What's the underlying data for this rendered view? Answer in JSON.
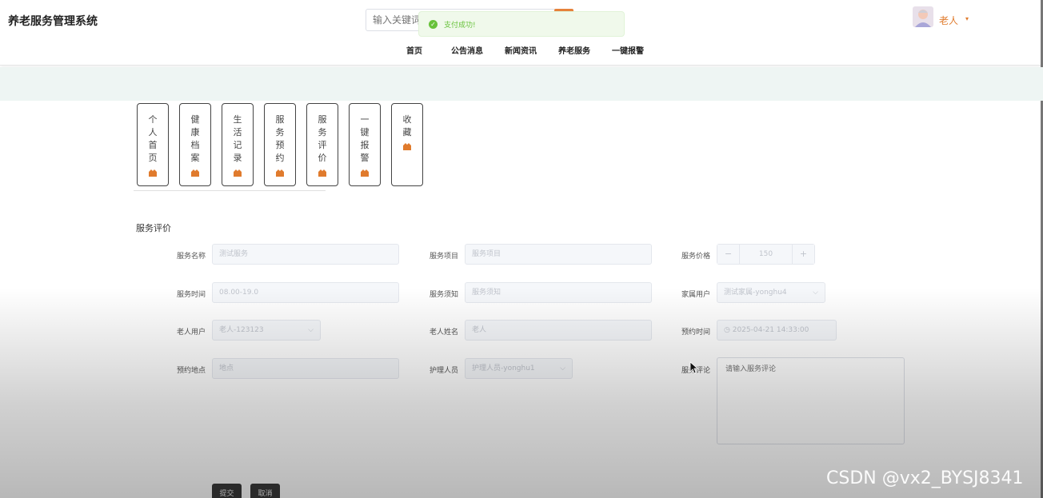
{
  "header": {
    "app_title": "养老服务管理系统",
    "search_placeholder": "输入关键词",
    "toast_message": "支付成功!",
    "nav": [
      "首页",
      "公告消息",
      "新闻资讯",
      "养老服务",
      "一键报警"
    ],
    "username": "老人",
    "caret": "▾"
  },
  "menu": [
    "个人首页",
    "健康档案",
    "生活记录",
    "服务预约",
    "服务评价",
    "一键报警",
    "收藏"
  ],
  "section_title": "服务评价",
  "form": {
    "service_name": {
      "label": "服务名称",
      "value": "测试服务"
    },
    "service_item": {
      "label": "服务项目",
      "value": "服务项目"
    },
    "service_price": {
      "label": "服务价格",
      "value": "150",
      "minus": "−",
      "plus": "+"
    },
    "service_time": {
      "label": "服务时间",
      "value": "08.00-19.0"
    },
    "service_notice": {
      "label": "服务须知",
      "value": "服务须知"
    },
    "family_user": {
      "label": "家属用户",
      "value": "测试家属-yonghu4"
    },
    "elder_user": {
      "label": "老人用户",
      "value": "老人-123123"
    },
    "elder_name": {
      "label": "老人姓名",
      "value": "老人"
    },
    "appointment_time": {
      "label": "预约时间",
      "value": "2025-04-21 14:33:00",
      "icon": "◷"
    },
    "appointment_place": {
      "label": "预约地点",
      "value": "地点"
    },
    "nurse": {
      "label": "护理人员",
      "value": "护理人员-yonghu1"
    },
    "service_review": {
      "label": "服务评论",
      "placeholder": "请输入服务评论"
    }
  },
  "buttons": {
    "submit": "提交",
    "cancel": "取消"
  },
  "watermark": "CSDN @vx2_BYSJ8341"
}
